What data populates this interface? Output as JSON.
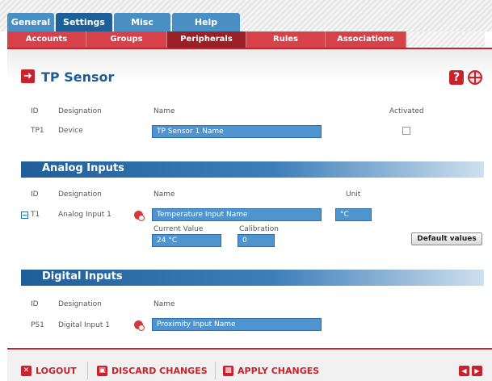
{
  "top_tabs": [
    {
      "label": "General"
    },
    {
      "label": "Settings"
    },
    {
      "label": "Misc"
    },
    {
      "label": "Help"
    }
  ],
  "sub_tabs": [
    {
      "label": "Accounts"
    },
    {
      "label": "Groups"
    },
    {
      "label": "Peripherals"
    },
    {
      "label": "Rules"
    },
    {
      "label": "Associations"
    }
  ],
  "page": {
    "title": "TP Sensor"
  },
  "device": {
    "headers": {
      "id": "ID",
      "designation": "Designation",
      "name": "Name",
      "activated": "Activated"
    },
    "row": {
      "id": "TP1",
      "designation": "Device",
      "name": "TP Sensor 1 Name",
      "activated": false
    }
  },
  "analog": {
    "title": "Analog Inputs",
    "headers": {
      "id": "ID",
      "designation": "Designation",
      "name": "Name",
      "unit": "Unit"
    },
    "row": {
      "id": "T1",
      "designation": "Analog Input 1",
      "name": "Temperature Input Name",
      "unit": "°C",
      "current_value_label": "Current Value",
      "current_value": "24 °C",
      "calibration_label": "Calibration",
      "calibration": "0"
    },
    "default_button": "Default values"
  },
  "digital": {
    "title": "Digital Inputs",
    "headers": {
      "id": "ID",
      "designation": "Designation",
      "name": "Name"
    },
    "row": {
      "id": "PS1",
      "designation": "Digital Input 1",
      "name": "Proximity Input Name"
    }
  },
  "footer": {
    "logout": "LOGOUT",
    "discard": "DISCARD CHANGES",
    "apply": "APPLY CHANGES"
  },
  "colors": {
    "accent_red": "#c8232c",
    "accent_blue": "#1f5d98",
    "input_blue": "#4f94cf"
  }
}
